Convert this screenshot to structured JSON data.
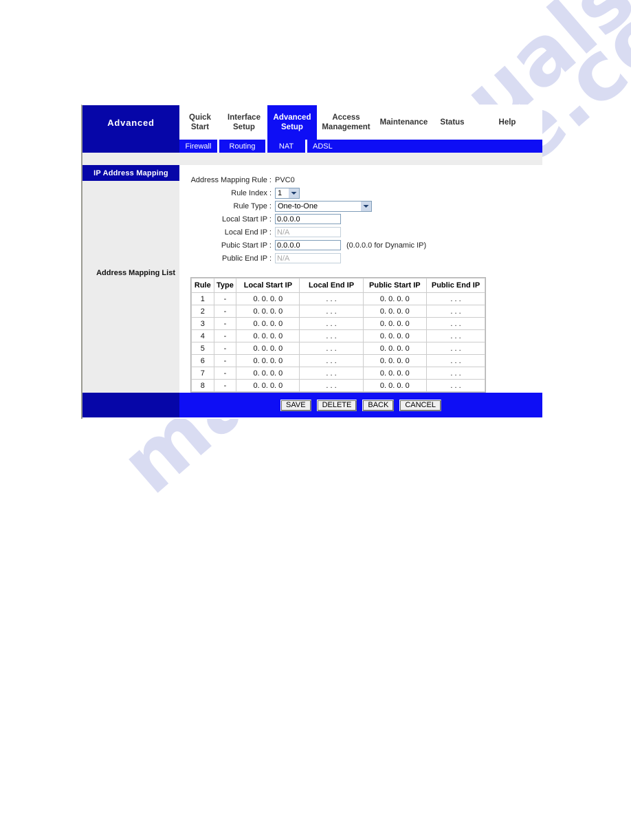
{
  "watermark": {
    "line1": "manualslive",
    "line2": "manualslive.com"
  },
  "brand": {
    "label": "Advanced"
  },
  "topnav": {
    "tabs": [
      {
        "label": "Quick\nStart",
        "active": false
      },
      {
        "label": "Interface\nSetup",
        "active": false
      },
      {
        "label": "Advanced\nSetup",
        "active": true
      },
      {
        "label": "Access\nManagement",
        "active": false
      },
      {
        "label": "Maintenance",
        "active": false
      },
      {
        "label": "Status",
        "active": false
      },
      {
        "label": "Help",
        "active": false
      }
    ]
  },
  "subnav": {
    "tabs": [
      {
        "label": "Firewall"
      },
      {
        "label": "Routing"
      },
      {
        "label": "NAT"
      },
      {
        "label": "ADSL"
      }
    ]
  },
  "sidebar": {
    "title": "IP Address Mapping",
    "section_label": "Address Mapping List"
  },
  "form": {
    "address_mapping_rule_label": "Address Mapping Rule :",
    "address_mapping_rule_value": "PVC0",
    "rule_index_label": "Rule Index :",
    "rule_index_value": "1",
    "rule_type_label": "Rule Type :",
    "rule_type_value": "One-to-One",
    "local_start_ip_label": "Local Start IP :",
    "local_start_ip_value": "0.0.0.0",
    "local_end_ip_label": "Local End IP :",
    "local_end_ip_value": "N/A",
    "public_start_ip_label": "Pubic Start IP :",
    "public_start_ip_value": "0.0.0.0",
    "public_start_ip_hint": "(0.0.0.0 for Dynamic IP)",
    "public_end_ip_label": "Public End IP :",
    "public_end_ip_value": "N/A"
  },
  "table": {
    "headers": [
      "Rule",
      "Type",
      "Local Start IP",
      "Local End IP",
      "Public Start IP",
      "Public End IP"
    ],
    "rows": [
      [
        "1",
        "-",
        "0. 0. 0. 0",
        ". . .",
        "0. 0. 0. 0",
        ". . ."
      ],
      [
        "2",
        "-",
        "0. 0. 0. 0",
        ". . .",
        "0. 0. 0. 0",
        ". . ."
      ],
      [
        "3",
        "-",
        "0. 0. 0. 0",
        ". . .",
        "0. 0. 0. 0",
        ". . ."
      ],
      [
        "4",
        "-",
        "0. 0. 0. 0",
        ". . .",
        "0. 0. 0. 0",
        ". . ."
      ],
      [
        "5",
        "-",
        "0. 0. 0. 0",
        ". . .",
        "0. 0. 0. 0",
        ". . ."
      ],
      [
        "6",
        "-",
        "0. 0. 0. 0",
        ". . .",
        "0. 0. 0. 0",
        ". . ."
      ],
      [
        "7",
        "-",
        "0. 0. 0. 0",
        ". . .",
        "0. 0. 0. 0",
        ". . ."
      ],
      [
        "8",
        "-",
        "0. 0. 0. 0",
        ". . .",
        "0. 0. 0. 0",
        ". . ."
      ]
    ]
  },
  "footer": {
    "buttons": [
      {
        "label": "SAVE"
      },
      {
        "label": "DELETE"
      },
      {
        "label": "BACK"
      },
      {
        "label": "CANCEL"
      }
    ]
  },
  "colors": {
    "brand_navy": "#0606a8",
    "nav_blue": "#0e0ef5",
    "sidebar_gray": "#ececec",
    "band_gray": "#ededed",
    "watermark": "#d9dcf2"
  }
}
